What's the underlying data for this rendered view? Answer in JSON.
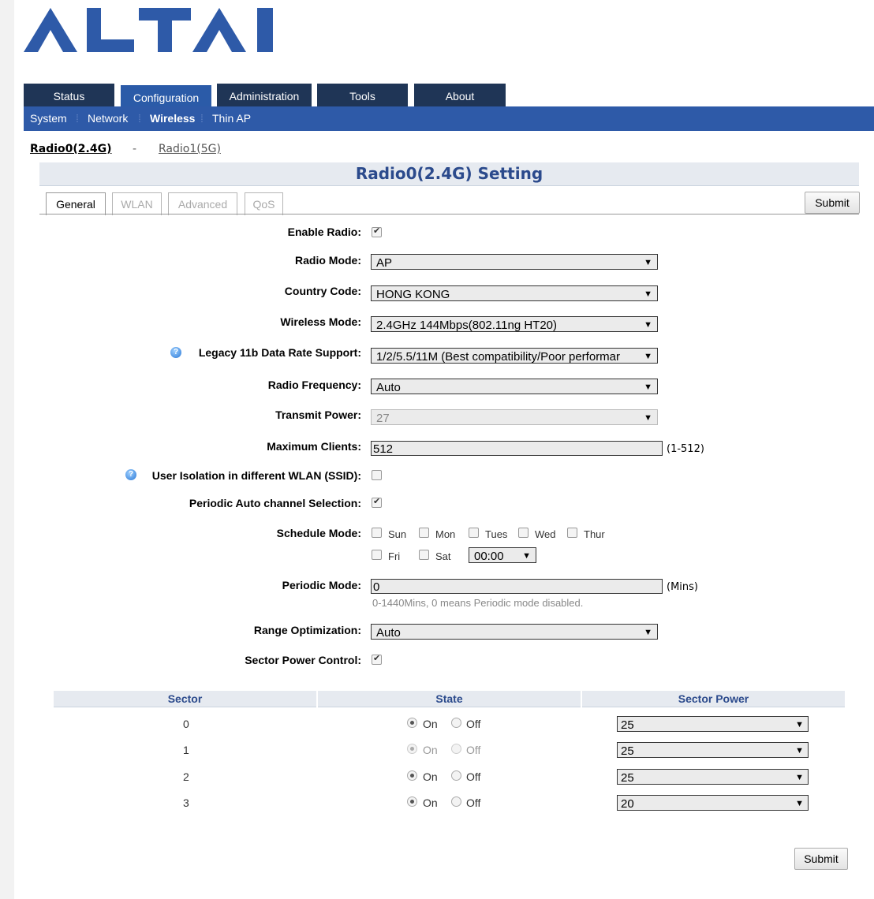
{
  "brand": {
    "logo_text": "ALTAI",
    "color": "#2e5aa8"
  },
  "main_tabs": [
    {
      "label": "Status"
    },
    {
      "label": "Configuration",
      "active": true
    },
    {
      "label": "Administration"
    },
    {
      "label": "Tools"
    },
    {
      "label": "About"
    }
  ],
  "sub_nav": [
    {
      "label": "System"
    },
    {
      "label": "Network"
    },
    {
      "label": "Wireless",
      "active": true
    },
    {
      "label": "Thin AP"
    }
  ],
  "radio_links": {
    "radio0": "Radio0(2.4G)",
    "dash": "-",
    "radio1": "Radio1(5G)"
  },
  "page_title": "Radio0(2.4G) Setting",
  "sub_tabs": [
    {
      "label": "General",
      "active": true
    },
    {
      "label": "WLAN"
    },
    {
      "label": "Advanced"
    },
    {
      "label": "QoS"
    }
  ],
  "submit_label": "Submit",
  "form": {
    "enable_radio": {
      "label": "Enable Radio:",
      "checked": true
    },
    "radio_mode": {
      "label": "Radio Mode:",
      "value": "AP"
    },
    "country_code": {
      "label": "Country Code:",
      "value": "HONG KONG"
    },
    "wireless_mode": {
      "label": "Wireless Mode:",
      "value": "2.4GHz 144Mbps(802.11ng HT20)"
    },
    "legacy_rate": {
      "label": "Legacy 11b Data Rate Support:",
      "value": "1/2/5.5/11M (Best compatibility/Poor performar"
    },
    "radio_frequency": {
      "label": "Radio Frequency:",
      "value": "Auto"
    },
    "transmit_power": {
      "label": "Transmit Power:",
      "value": "27"
    },
    "max_clients": {
      "label": "Maximum Clients:",
      "value": "512",
      "unit": "(1-512)"
    },
    "user_isolation": {
      "label": "User Isolation in different WLAN (SSID):",
      "checked": false
    },
    "periodic_acs": {
      "label": "Periodic Auto channel Selection:",
      "checked": true
    },
    "schedule_mode": {
      "label": "Schedule Mode:",
      "days": [
        "Sun",
        "Mon",
        "Tues",
        "Wed",
        "Thur",
        "Fri",
        "Sat"
      ],
      "time": "00:00"
    },
    "periodic_mode": {
      "label": "Periodic Mode:",
      "value": "0",
      "unit": "(Mins)",
      "hint": "0-1440Mins, 0 means Periodic mode disabled."
    },
    "range_optimization": {
      "label": "Range Optimization:",
      "value": "Auto"
    },
    "sector_power_control": {
      "label": "Sector Power Control:",
      "checked": true
    }
  },
  "sector_table": {
    "headers": [
      "Sector",
      "State",
      "Sector Power"
    ],
    "on_label": "On",
    "off_label": "Off",
    "rows": [
      {
        "sector": "0",
        "state": "On",
        "disabled": false,
        "power": "25"
      },
      {
        "sector": "1",
        "state": "On",
        "disabled": true,
        "power": "25"
      },
      {
        "sector": "2",
        "state": "On",
        "disabled": false,
        "power": "25"
      },
      {
        "sector": "3",
        "state": "On",
        "disabled": false,
        "power": "20"
      }
    ]
  }
}
